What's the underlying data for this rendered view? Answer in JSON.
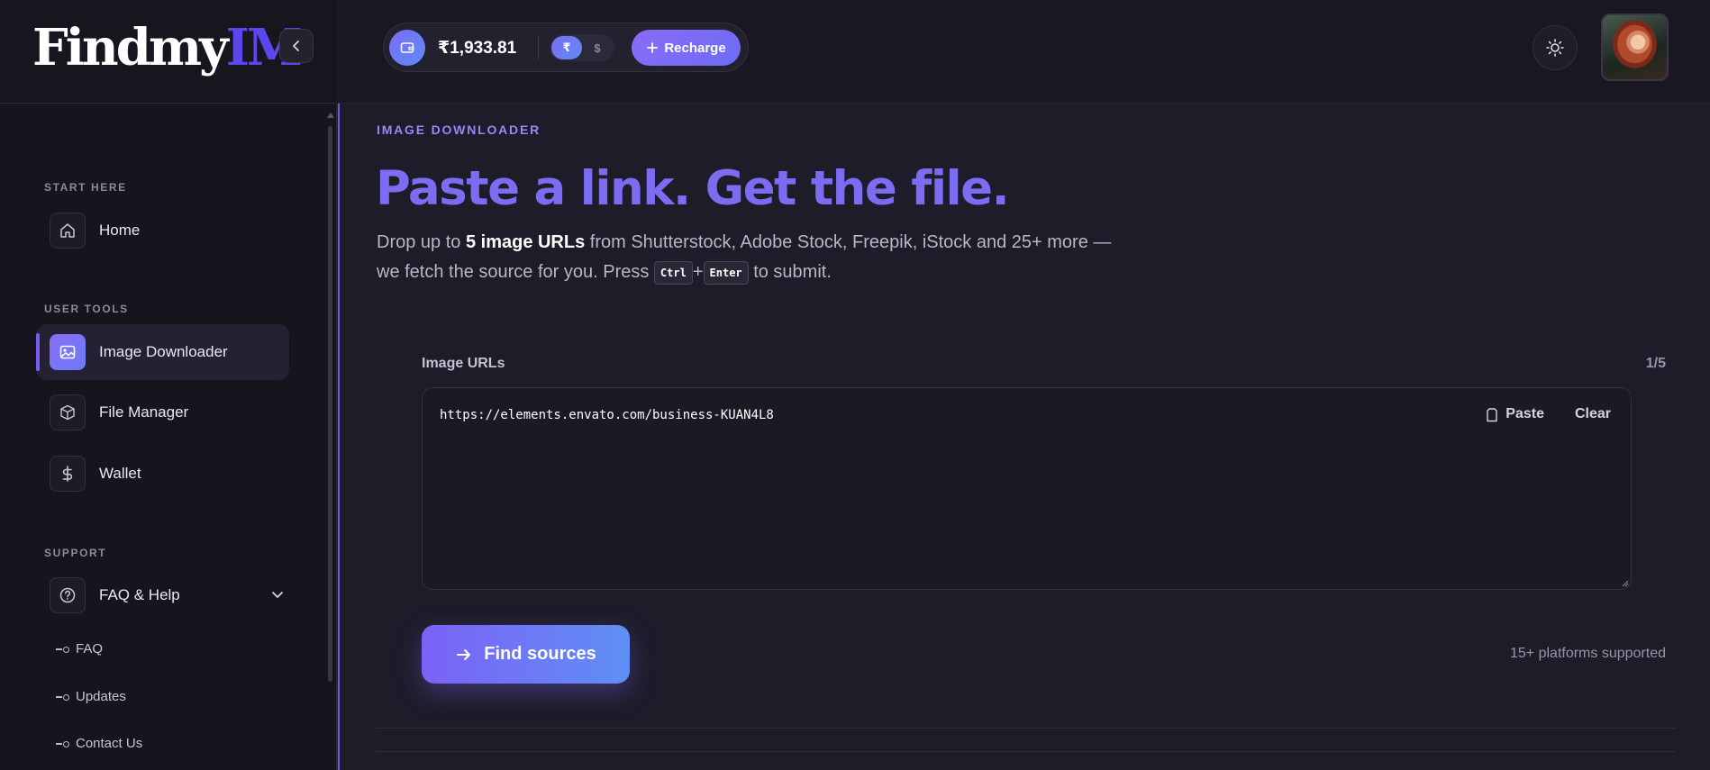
{
  "brand": {
    "part1": "Findmy",
    "part2": "IMG"
  },
  "topbar": {
    "balance": "₹1,933.81",
    "currency_inr": "₹",
    "currency_usd": "$",
    "recharge_label": "Recharge"
  },
  "sidebar": {
    "sections": [
      {
        "label": "START HERE",
        "items": [
          {
            "label": "Home",
            "icon": "home-icon"
          }
        ]
      },
      {
        "label": "USER TOOLS",
        "items": [
          {
            "label": "Image Downloader",
            "icon": "image-icon",
            "active": true
          },
          {
            "label": "File Manager",
            "icon": "box-icon"
          },
          {
            "label": "Wallet",
            "icon": "dollar-icon"
          }
        ]
      },
      {
        "label": "SUPPORT",
        "items": [
          {
            "label": "FAQ & Help",
            "icon": "help-circle-icon",
            "expanded": true,
            "children": [
              {
                "label": "FAQ"
              },
              {
                "label": "Updates"
              },
              {
                "label": "Contact Us"
              }
            ]
          }
        ]
      }
    ]
  },
  "main": {
    "eyebrow": "IMAGE DOWNLOADER",
    "headline": "Paste a link. Get the file.",
    "lead_a": "Drop up to ",
    "lead_bold": "5 image URLs",
    "lead_b": " from Shutterstock, Adobe Stock, Freepik, iStock and 25+ more — we fetch the source for you. Press ",
    "key_ctrl": "Ctrl",
    "key_plus": "+",
    "key_enter": "Enter",
    "lead_c": " to submit.",
    "field_label": "Image URLs",
    "count": "1/5",
    "url_value": "https://elements.envato.com/business-KUAN4L8",
    "paste_label": "Paste",
    "clear_label": "Clear",
    "find_label": "Find sources",
    "platforms": "15+ platforms supported"
  },
  "colors": {
    "accent": "#7b6cf2",
    "accent_gradient_end": "#5e8ff4",
    "background": "#1e1c29",
    "sidebar": "#16141d"
  }
}
